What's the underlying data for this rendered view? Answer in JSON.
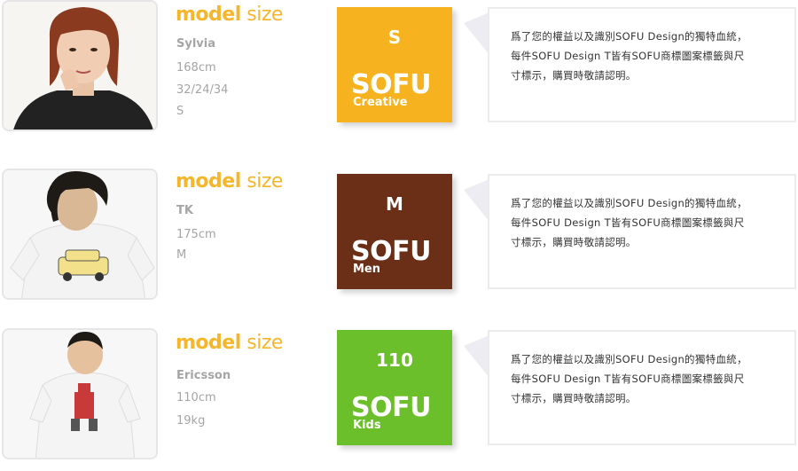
{
  "rows": [
    {
      "model_label": {
        "bold": "model",
        "light": "size"
      },
      "name": "Sylvia",
      "stats": [
        "168cm",
        "32/24/34",
        "S"
      ],
      "badge": {
        "size": "S",
        "logo": "SOFU",
        "line": "Creative",
        "color": "#f6b21f"
      },
      "notice": [
        "爲了您的權益以及識別SOFU Design的獨特血統，",
        "每件SOFU Design T皆有SOFU商標圖案標籤與尺",
        "寸標示，購買時敬請認明。"
      ]
    },
    {
      "model_label": {
        "bold": "model",
        "light": "size"
      },
      "name": "TK",
      "stats": [
        "175cm",
        "M"
      ],
      "badge": {
        "size": "M",
        "logo": "SOFU",
        "line": "Men",
        "color": "#6b2e16"
      },
      "notice": [
        "爲了您的權益以及識別SOFU Design的獨特血統，",
        "每件SOFU Design T皆有SOFU商標圖案標籤與尺",
        "寸標示，購買時敬請認明。"
      ]
    },
    {
      "model_label": {
        "bold": "model",
        "light": "size"
      },
      "name": "Ericsson",
      "stats": [
        "110cm",
        "19kg"
      ],
      "badge": {
        "size": "110",
        "logo": "SOFU",
        "line": "Kids",
        "color": "#6bbf2b"
      },
      "notice": [
        "爲了您的權益以及識別SOFU Design的獨特血統，",
        "每件SOFU Design T皆有SOFU商標圖案標籤與尺",
        "寸標示，購買時敬請認明。"
      ]
    }
  ]
}
